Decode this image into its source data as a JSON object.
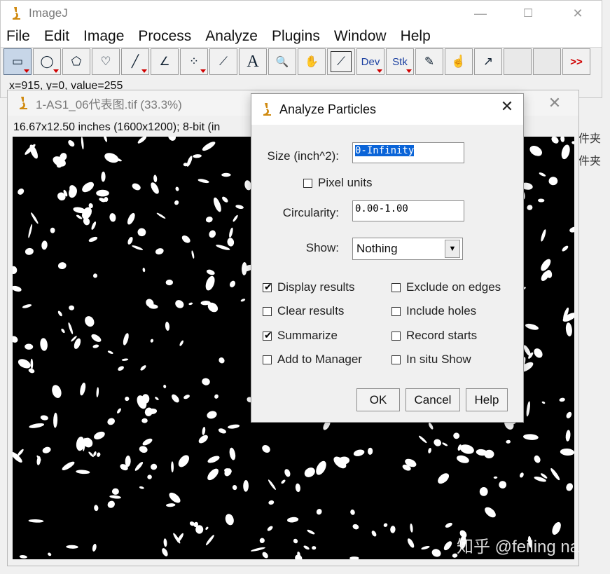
{
  "main_window": {
    "title": "ImageJ",
    "controls": {
      "minimize": "—",
      "maximize": "☐",
      "close": "✕"
    },
    "menu": [
      "File",
      "Edit",
      "Image",
      "Process",
      "Analyze",
      "Plugins",
      "Window",
      "Help"
    ],
    "tools": [
      {
        "name": "rectangle-tool-icon",
        "glyph": "▭"
      },
      {
        "name": "oval-tool-icon",
        "glyph": "◯"
      },
      {
        "name": "polygon-tool-icon",
        "glyph": "⬠"
      },
      {
        "name": "freehand-tool-icon",
        "glyph": "♡"
      },
      {
        "name": "line-tool-icon",
        "glyph": "╱"
      },
      {
        "name": "angle-tool-icon",
        "glyph": "∠"
      },
      {
        "name": "multipoint-tool-icon",
        "glyph": "⁘"
      },
      {
        "name": "wand-tool-icon",
        "glyph": "⟋"
      },
      {
        "name": "text-tool-icon",
        "glyph": "A"
      },
      {
        "name": "magnifier-tool-icon",
        "glyph": "🔍"
      },
      {
        "name": "hand-tool-icon",
        "glyph": "✋"
      },
      {
        "name": "color-picker-tool-icon",
        "glyph": "⟋"
      },
      {
        "name": "dev-menu-tool",
        "glyph": "Dev"
      },
      {
        "name": "stk-menu-tool",
        "glyph": "Stk"
      },
      {
        "name": "brush-tool-icon",
        "glyph": "✎"
      },
      {
        "name": "touch-tool-icon",
        "glyph": "☝"
      },
      {
        "name": "arrow-tool-icon",
        "glyph": "↗"
      },
      {
        "name": "empty-tool-slot",
        "glyph": ""
      },
      {
        "name": "empty-tool-slot",
        "glyph": ""
      },
      {
        "name": "more-tools-button",
        "glyph": ">>"
      }
    ],
    "status": "x=915, y=0, value=255"
  },
  "image_window": {
    "title": "1-AS1_06代表图.tif (33.3%)",
    "info": "16.67x12.50 inches (1600x1200); 8-bit (in"
  },
  "side_text": [
    "件夹",
    "件夹"
  ],
  "watermark": "知乎 @feiling na",
  "dialog": {
    "title": "Analyze Particles",
    "size_label": "Size (inch^2):",
    "size_value": "0-Infinity",
    "pixel_units_label": "Pixel units",
    "pixel_units_checked": false,
    "circularity_label": "Circularity:",
    "circularity_value": "0.00-1.00",
    "show_label": "Show:",
    "show_value": "Nothing",
    "checkboxes_left": [
      {
        "label": "Display results",
        "checked": true
      },
      {
        "label": "Clear results",
        "checked": false
      },
      {
        "label": "Summarize",
        "checked": true
      },
      {
        "label": "Add to Manager",
        "checked": false
      }
    ],
    "checkboxes_right": [
      {
        "label": "Exclude on edges",
        "checked": false
      },
      {
        "label": "Include holes",
        "checked": false
      },
      {
        "label": "Record starts",
        "checked": false
      },
      {
        "label": "In situ Show",
        "checked": false
      }
    ],
    "buttons": {
      "ok": "OK",
      "cancel": "Cancel",
      "help": "Help"
    },
    "close": "✕"
  }
}
